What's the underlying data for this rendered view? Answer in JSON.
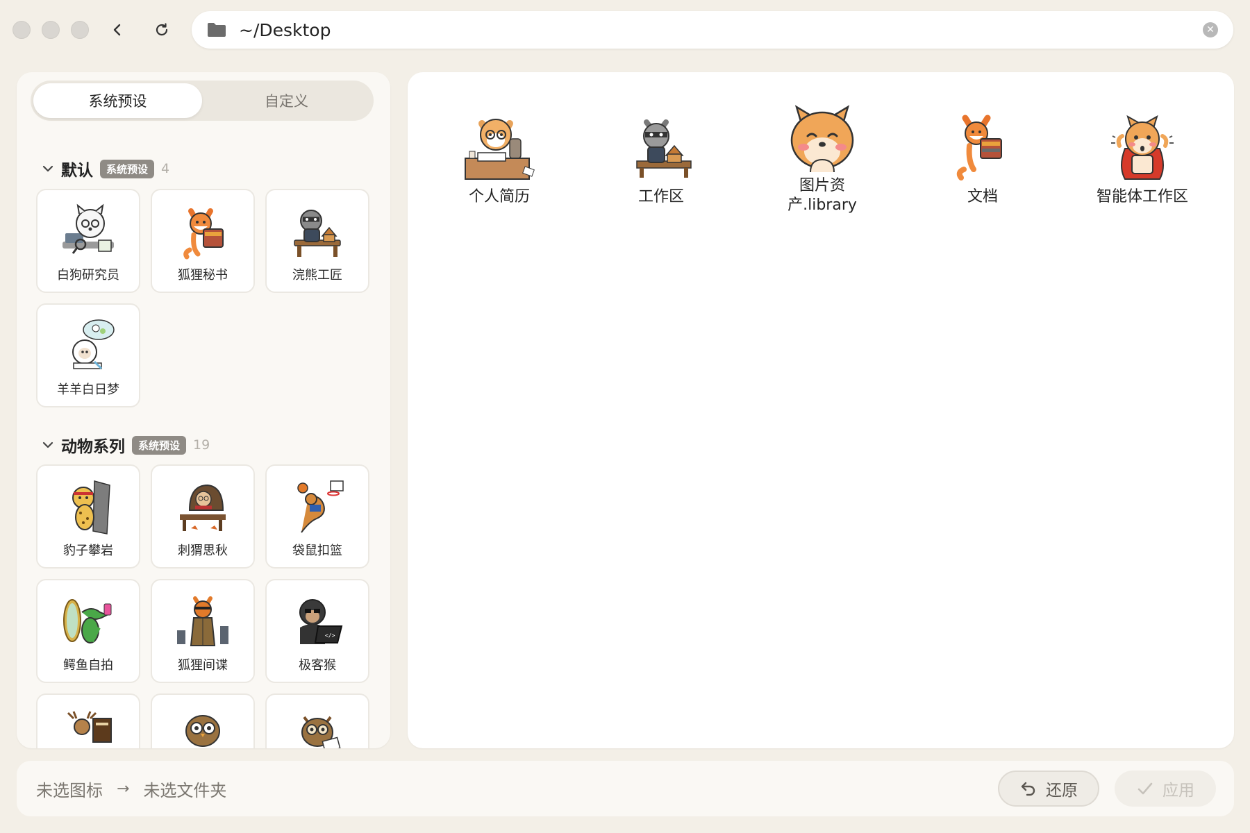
{
  "address": {
    "path": "~/Desktop"
  },
  "tabs": [
    {
      "label": "系统预设"
    },
    {
      "label": "自定义"
    }
  ],
  "groups": [
    {
      "title": "默认",
      "badge": "系统预设",
      "count": "4",
      "items": [
        {
          "label": "白狗研究员"
        },
        {
          "label": "狐狸秘书"
        },
        {
          "label": "浣熊工匠"
        },
        {
          "label": "羊羊白日梦"
        }
      ]
    },
    {
      "title": "动物系列",
      "badge": "系统预设",
      "count": "19",
      "items": [
        {
          "label": "豹子攀岩"
        },
        {
          "label": "刺猬思秋"
        },
        {
          "label": "袋鼠扣篮"
        },
        {
          "label": "鳄鱼自拍"
        },
        {
          "label": "狐狸间谍"
        },
        {
          "label": "极客猴"
        }
      ]
    }
  ],
  "folders": [
    {
      "label": "个人简历"
    },
    {
      "label": "工作区"
    },
    {
      "label1": "图片资",
      "label2": "产.library"
    },
    {
      "label": "文档"
    },
    {
      "label": "智能体工作区"
    }
  ],
  "footer": {
    "icon_status": "未选图标",
    "folder_status": "未选文件夹",
    "restore": "还原",
    "apply": "应用"
  }
}
